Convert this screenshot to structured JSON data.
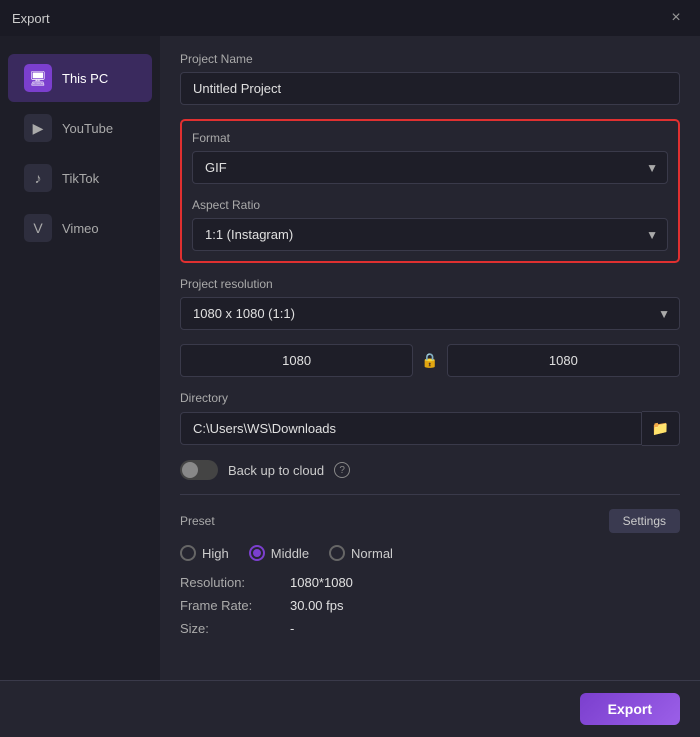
{
  "window": {
    "title": "Export",
    "close_label": "×"
  },
  "sidebar": {
    "items": [
      {
        "id": "this-pc",
        "label": "This PC",
        "icon": "🖥",
        "active": true
      },
      {
        "id": "youtube",
        "label": "YouTube",
        "icon": "▶",
        "active": false
      },
      {
        "id": "tiktok",
        "label": "TikTok",
        "icon": "♪",
        "active": false
      },
      {
        "id": "vimeo",
        "label": "Vimeo",
        "icon": "V",
        "active": false
      }
    ]
  },
  "main": {
    "project_name_label": "Project Name",
    "project_name_value": "Untitled Project",
    "format_label": "Format",
    "format_value": "GIF",
    "aspect_ratio_label": "Aspect Ratio",
    "aspect_ratio_value": "1:1 (Instagram)",
    "project_resolution_label": "Project resolution",
    "project_resolution_value": "1080 x 1080 (1:1)",
    "resolution_w": "1080",
    "resolution_h": "1080",
    "directory_label": "Directory",
    "directory_value": "C:\\Users\\WS\\Downloads",
    "backup_label": "Back up to cloud",
    "preset_label": "Preset",
    "settings_label": "Settings",
    "preset_options": [
      {
        "id": "high",
        "label": "High",
        "checked": false
      },
      {
        "id": "middle",
        "label": "Middle",
        "checked": true
      },
      {
        "id": "normal",
        "label": "Normal",
        "checked": false
      }
    ],
    "resolution_key": "Resolution:",
    "resolution_spec": "1080*1080",
    "frame_rate_key": "Frame Rate:",
    "frame_rate_spec": "30.00 fps",
    "size_key": "Size:",
    "size_spec": "-",
    "export_label": "Export"
  }
}
